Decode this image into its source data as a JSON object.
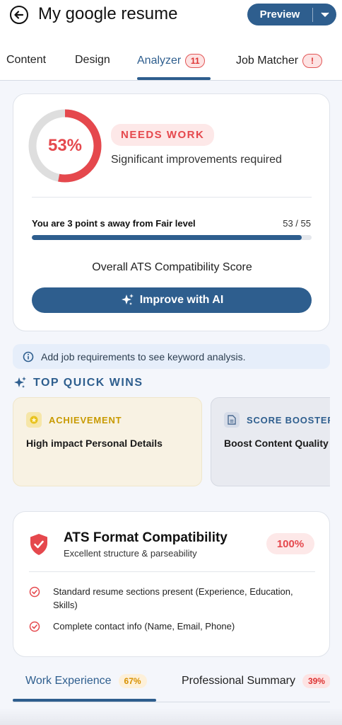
{
  "header": {
    "title": "My google resume",
    "preview_label": "Preview"
  },
  "tabs": [
    {
      "label": "Content"
    },
    {
      "label": "Design"
    },
    {
      "label": "Analyzer",
      "badge": "11"
    },
    {
      "label": "Job Matcher",
      "badge": "!"
    }
  ],
  "score": {
    "percent_label": "53%",
    "percent_value": 53,
    "status": "NEEDS WORK",
    "status_sub": "Significant improvements required",
    "progress_label": "You are 3 point s away from Fair level",
    "progress_value": "53 / 55",
    "progress_fraction": 0.9636,
    "ats_label": "Overall ATS Compatibility Score",
    "improve_label": "Improve with AI"
  },
  "info_banner": "Add job requirements to see keyword analysis.",
  "quick_wins": {
    "title": "TOP QUICK WINS",
    "cards": [
      {
        "tag": "ACHIEVEMENT",
        "title": "High impact Personal Details"
      },
      {
        "tag": "SCORE BOOSTER",
        "title": "Boost Content Quality"
      }
    ]
  },
  "ats_format": {
    "title": "ATS Format Compatibility",
    "subtitle": "Excellent structure & parseability",
    "score": "100%",
    "items": [
      "Standard resume sections present (Experience, Education, Skills)",
      "Complete contact info (Name, Email, Phone)"
    ]
  },
  "section_tabs": [
    {
      "label": "Work Experience",
      "badge": "67%"
    },
    {
      "label": "Professional Summary",
      "badge": "39%"
    }
  ],
  "colors": {
    "primary": "#2e5e8e",
    "danger": "#e5484d",
    "warning": "#d89100"
  }
}
